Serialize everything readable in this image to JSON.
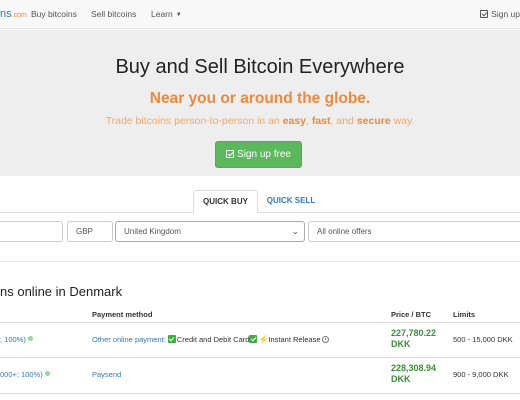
{
  "navbar": {
    "brand": "ns",
    "brand_suffix": ".com",
    "buy_label": "Buy bitcoins",
    "sell_label": "Sell bitcoins",
    "learn_label": "Learn",
    "signup_label": "Sign up"
  },
  "hero": {
    "title": "Buy and Sell Bitcoin Everywhere",
    "subtitle": "Near you or around the globe.",
    "desc_part1": "Trade bitcoins person-to-person in an ",
    "easy": "easy",
    "comma": ", ",
    "fast": "fast",
    "and": ", and ",
    "secure": "secure",
    "way": " way.",
    "signup_button": "Sign up free"
  },
  "tabs": {
    "quick_buy": "QUICK BUY",
    "quick_sell": "QUICK SELL"
  },
  "search": {
    "amount": "",
    "currency": "GBP",
    "country": "United Kingdom",
    "offers": "All online offers"
  },
  "section_title": "ns online in Denmark",
  "table": {
    "headers": {
      "payment_method": "Payment method",
      "price": "Price / BTC",
      "limits": "Limits"
    },
    "rows": [
      {
        "seller": "; 100%)",
        "payment": "Other online payment:",
        "tag1": "Credit and Debit Card",
        "tag2": "Instant Release",
        "price": "227,780.22 DKK",
        "limits": "500 - 15,000 DKK"
      },
      {
        "seller": "000+; 100%)",
        "payment": "Paysend",
        "price": "228,308.94 DKK",
        "limits": "900 - 9,000 DKK"
      }
    ]
  },
  "colors": {
    "brand_blue": "#337ab7",
    "accent_orange": "#f0883a",
    "success_green": "#5cb85c",
    "price_green": "#3c8d3c"
  }
}
